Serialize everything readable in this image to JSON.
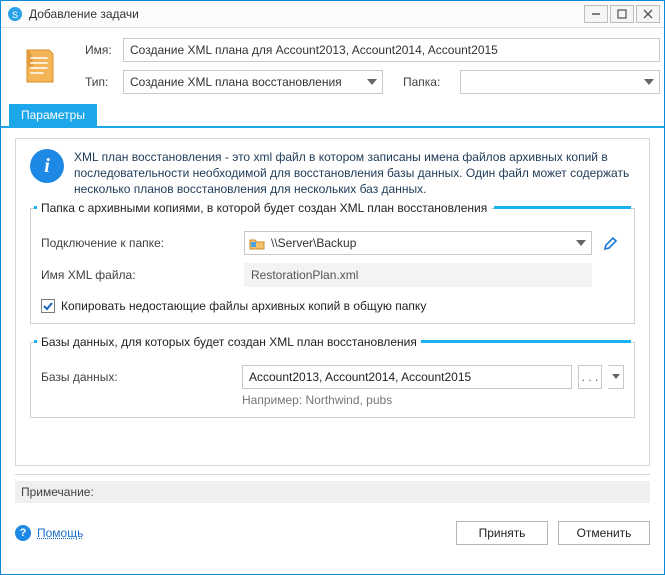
{
  "window": {
    "title": "Добавление задачи"
  },
  "header": {
    "name_label": "Имя:",
    "name_value": "Создание XML плана для Account2013, Account2014, Account2015",
    "type_label": "Тип:",
    "type_value": "Создание XML плана восстановления",
    "folder_label": "Папка:",
    "folder_value": ""
  },
  "tabs": {
    "parameters": "Параметры"
  },
  "info": {
    "text": "XML план восстановления - это xml файл в котором записаны имена файлов архивных копий в последовательности необходимой для восстановления базы данных. Один файл может содержать несколько планов восстановления для нескольких баз данных."
  },
  "group_folder": {
    "title": "Папка с архивными копиями, в которой будет создан XML план восстановления",
    "connection_label": "Подключение к папке:",
    "connection_value": "\\\\Server\\Backup",
    "xml_label": "Имя XML файла:",
    "xml_value": "RestorationPlan.xml",
    "copy_checkbox_label": "Копировать недостающие файлы архивных копий в общую папку",
    "copy_checked": true
  },
  "group_db": {
    "title": "Базы данных, для которых будет создан XML план восстановления",
    "db_label": "Базы данных:",
    "db_value": "Account2013, Account2014, Account2015",
    "db_hint": "Например: Northwind, pubs",
    "browse_label": ". . ."
  },
  "note": {
    "label": "Примечание:",
    "value": ""
  },
  "footer": {
    "help": "Помощь",
    "accept": "Принять",
    "cancel": "Отменить"
  }
}
